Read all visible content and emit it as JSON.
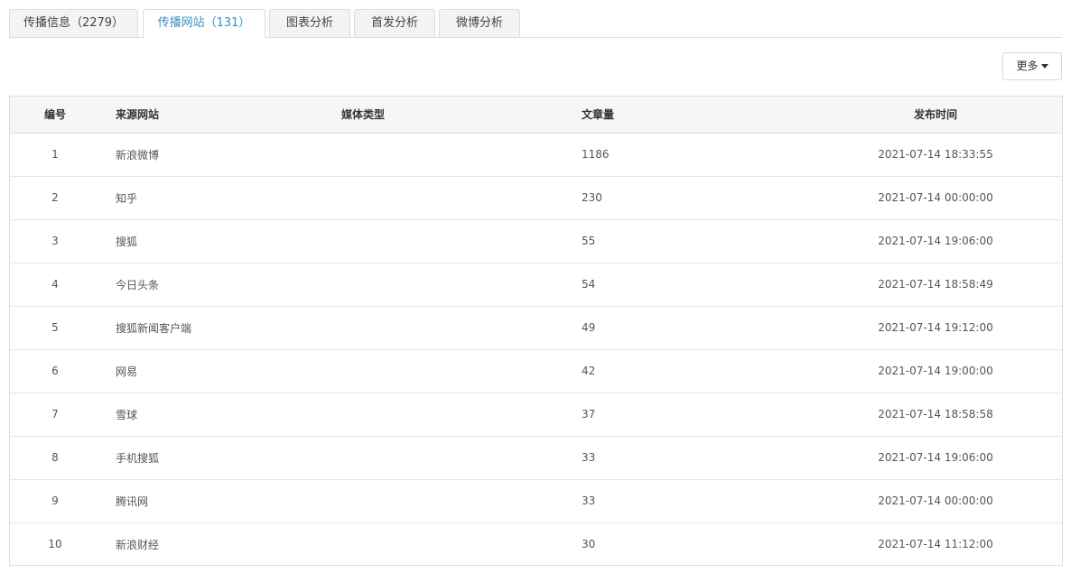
{
  "tabs": [
    {
      "label": "传播信息（2279）"
    },
    {
      "label": "传播网站（131）"
    },
    {
      "label": "图表分析"
    },
    {
      "label": "首发分析"
    },
    {
      "label": "微博分析"
    }
  ],
  "toolbar": {
    "more_label": "更多"
  },
  "table": {
    "headers": {
      "number": "编号",
      "source": "来源网站",
      "media_type": "媒体类型",
      "article_count": "文章量",
      "publish_time": "发布时间"
    },
    "rows": [
      {
        "number": "1",
        "source": "新浪微博",
        "media_type": "",
        "article_count": "1186",
        "publish_time": "2021-07-14 18:33:55"
      },
      {
        "number": "2",
        "source": "知乎",
        "media_type": "",
        "article_count": "230",
        "publish_time": "2021-07-14 00:00:00"
      },
      {
        "number": "3",
        "source": "搜狐",
        "media_type": "",
        "article_count": "55",
        "publish_time": "2021-07-14 19:06:00"
      },
      {
        "number": "4",
        "source": "今日头条",
        "media_type": "",
        "article_count": "54",
        "publish_time": "2021-07-14 18:58:49"
      },
      {
        "number": "5",
        "source": "搜狐新闻客户端",
        "media_type": "",
        "article_count": "49",
        "publish_time": "2021-07-14 19:12:00"
      },
      {
        "number": "6",
        "source": "网易",
        "media_type": "",
        "article_count": "42",
        "publish_time": "2021-07-14 19:00:00"
      },
      {
        "number": "7",
        "source": "雪球",
        "media_type": "",
        "article_count": "37",
        "publish_time": "2021-07-14 18:58:58"
      },
      {
        "number": "8",
        "source": "手机搜狐",
        "media_type": "",
        "article_count": "33",
        "publish_time": "2021-07-14 19:06:00"
      },
      {
        "number": "9",
        "source": "腾讯网",
        "media_type": "",
        "article_count": "33",
        "publish_time": "2021-07-14 00:00:00"
      },
      {
        "number": "10",
        "source": "新浪财经",
        "media_type": "",
        "article_count": "30",
        "publish_time": "2021-07-14 11:12:00"
      }
    ]
  }
}
